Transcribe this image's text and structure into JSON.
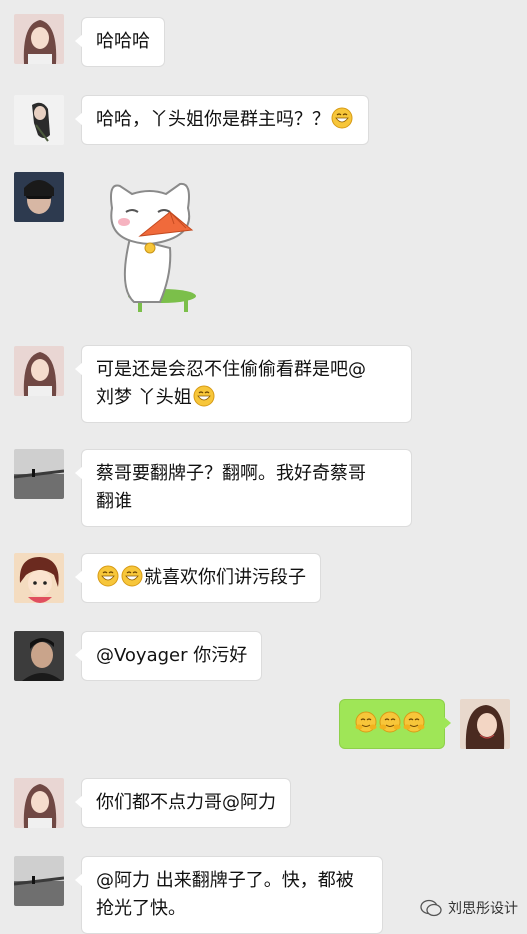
{
  "messages": [
    {
      "side": "left",
      "text": "哈哈哈"
    },
    {
      "side": "left",
      "text": "哈哈，丫头姐你是群主吗？？"
    },
    {
      "side": "left",
      "sticker": "cat-fan-sticker"
    },
    {
      "side": "left",
      "line1": "可是还是会忍不住偷偷看群是吧@",
      "line2": "刘梦 丫头姐"
    },
    {
      "side": "left",
      "line1": "蔡哥要翻牌子？翻啊。我好奇蔡哥",
      "line2": "翻谁"
    },
    {
      "side": "left",
      "text": "就喜欢你们讲污段子"
    },
    {
      "side": "left",
      "text": "@Voyager 你污好"
    },
    {
      "side": "right",
      "emoji_count": 3
    },
    {
      "side": "left",
      "text": "你们都不点力哥@阿力"
    },
    {
      "side": "left",
      "line1": "@阿力 出来翻牌子了。快，都被",
      "line2": "抢光了快。"
    }
  ],
  "watermark": {
    "text": "刘思彤设计"
  },
  "colors": {
    "background": "#ebebeb",
    "incoming": "#ffffff",
    "outgoing": "#9fe657"
  }
}
